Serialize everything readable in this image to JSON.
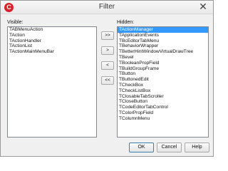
{
  "window": {
    "title": "Filter",
    "app_icon": "app-logo-icon",
    "close_glyph": "✕"
  },
  "visible": {
    "label": "Visible:",
    "items": [
      "TABMenuAction",
      "TAction",
      "TActionHandler",
      "TActionList",
      "TActionMainMenuBar"
    ]
  },
  "hidden": {
    "label": "Hidden:",
    "selected_index": 0,
    "items": [
      "TActionManager",
      "TApplicationEvents",
      "TBcEditorTabMenu",
      "TBehaviorWrapper",
      "TBetterHintWindowVirtualDrawTree",
      "TBevel",
      "TBooleanPropField",
      "TBuildGroupFrame",
      "TButton",
      "TButtonedEdit",
      "TCheckBox",
      "TCheckListBox",
      "TClosableTabScroller",
      "TCloseButton",
      "TCodeEditorTabControl",
      "TColorPropField",
      "TColumnMenu"
    ]
  },
  "move_buttons": {
    "move_all_right": ">>",
    "move_right": ">",
    "move_left": "<",
    "move_all_left": "<<"
  },
  "footer": {
    "ok_label": "OK",
    "cancel_label": "Cancel",
    "help_label": "Help"
  },
  "colors": {
    "selection": "#3399ff",
    "app_icon": "#d9202b"
  }
}
